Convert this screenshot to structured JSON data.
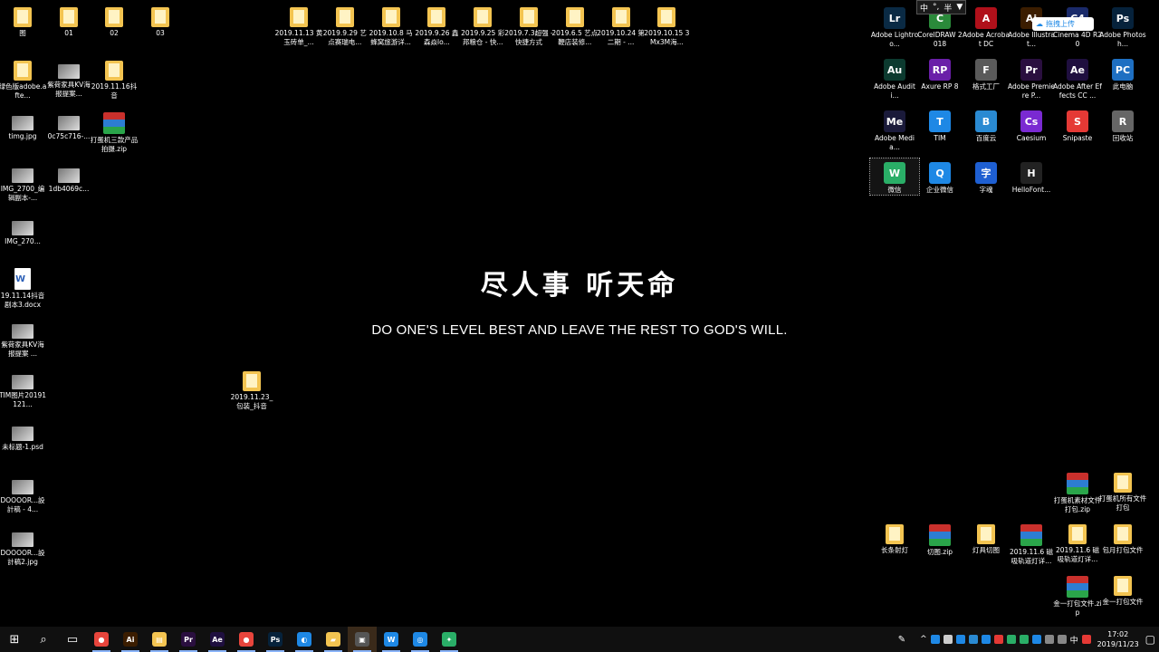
{
  "desktop": {
    "icons_left": [
      {
        "label": "图",
        "kind": "folder"
      },
      {
        "label": "01",
        "kind": "folder"
      },
      {
        "label": "02",
        "kind": "folder"
      },
      {
        "label": "03",
        "kind": "folder"
      },
      {
        "label": "绿色版adobe.afte...",
        "kind": "folder"
      },
      {
        "label": "紫荷家具KV海报提案...",
        "kind": "img"
      },
      {
        "label": "2019.11.16抖音",
        "kind": "folder"
      },
      {
        "label": "timg.jpg",
        "kind": "img"
      },
      {
        "label": "0c75c716-...",
        "kind": "img"
      },
      {
        "label": "打蛋机三款产品拍摄.zip",
        "kind": "zip"
      },
      {
        "label": "IMG_2700_编辑副本-...",
        "kind": "img"
      },
      {
        "label": "1db4069c...",
        "kind": "img"
      },
      {
        "label": "IMG_270...",
        "kind": "img"
      },
      {
        "label": "19.11.14抖音剧本3.docx",
        "kind": "doc"
      },
      {
        "label": "紫荷家具KV海报提案 ...",
        "kind": "img"
      },
      {
        "label": "TIM图片20191121...",
        "kind": "img"
      },
      {
        "label": "未标题-1.psd",
        "kind": "img"
      },
      {
        "label": "DOOOOR...設計稿 - 4...",
        "kind": "img"
      },
      {
        "label": "DOOOOR...設計稿2.jpg",
        "kind": "img"
      },
      {
        "label": "2019.11.23_包装_抖音",
        "kind": "folder"
      }
    ],
    "icons_top": [
      {
        "label": "2019.11.13 黄玉砖单_..."
      },
      {
        "label": "2019.9.29 艺点赛瑞电..."
      },
      {
        "label": "2019.10.8 马蜂窝旅游详..."
      },
      {
        "label": "2019.9.26 鑫森焱lo..."
      },
      {
        "label": "2019.9.25 彩邦粮仓 - 快..."
      },
      {
        "label": "2019.7.3超强 - 快捷方式"
      },
      {
        "label": "2019.6.5 艺点鞭店装修..."
      },
      {
        "label": "2019.10.24 第二期 - ..."
      },
      {
        "label": "2019.10.15 3Mx3M海..."
      }
    ],
    "icons_right": [
      {
        "label": "Adobe Lightroo...",
        "glyph": "Lr",
        "color": "#0a2a44"
      },
      {
        "label": "CorelDRAW 2018",
        "glyph": "C",
        "color": "#2a8a3a"
      },
      {
        "label": "Adobe Acrobat DC",
        "glyph": "A",
        "color": "#b0101a"
      },
      {
        "label": "Adobe Illustrat...",
        "glyph": "Ai",
        "color": "#3b1d00"
      },
      {
        "label": "Cinema 4D R20",
        "glyph": "C4",
        "color": "#1a2a6a"
      },
      {
        "label": "Adobe Photosh...",
        "glyph": "Ps",
        "color": "#06223b"
      },
      {
        "label": "Adobe Auditi...",
        "glyph": "Au",
        "color": "#0c3a2f"
      },
      {
        "label": "Axure RP 8",
        "glyph": "RP",
        "color": "#6a1fa8"
      },
      {
        "label": "格式工厂",
        "glyph": "F",
        "color": "#5a5a5a"
      },
      {
        "label": "Adobe Premiere P...",
        "glyph": "Pr",
        "color": "#2a0f3f"
      },
      {
        "label": "Adobe After Effects CC ...",
        "glyph": "Ae",
        "color": "#1f0f3f"
      },
      {
        "label": "此电脑",
        "glyph": "PC",
        "color": "#1e6fc2"
      },
      {
        "label": "Adobe Media...",
        "glyph": "Me",
        "color": "#1a1a3a"
      },
      {
        "label": "TIM",
        "glyph": "T",
        "color": "#1e88e5"
      },
      {
        "label": "百度云",
        "glyph": "B",
        "color": "#2a8ad2"
      },
      {
        "label": "Caesium",
        "glyph": "Cs",
        "color": "#7a2ad2"
      },
      {
        "label": "Snipaste",
        "glyph": "S",
        "color": "#e53935"
      },
      {
        "label": "回收站",
        "glyph": "R",
        "color": "#666"
      },
      {
        "label": "微信",
        "glyph": "W",
        "color": "#2aae67"
      },
      {
        "label": "企业微信",
        "glyph": "Q",
        "color": "#1e88e5"
      },
      {
        "label": "字魂",
        "glyph": "字",
        "color": "#1e5fd2"
      },
      {
        "label": "HelloFont...",
        "glyph": "H",
        "color": "#222"
      }
    ],
    "icons_bottom_right": [
      {
        "label": "打蛋机素材文件打包.zip",
        "kind": "zip"
      },
      {
        "label": "打蛋机所有文件打包",
        "kind": "folder"
      },
      {
        "label": "长条射灯",
        "kind": "folder"
      },
      {
        "label": "切图.zip",
        "kind": "zip"
      },
      {
        "label": "灯具切图",
        "kind": "folder"
      },
      {
        "label": "2019.11.6 磁吸轨道灯详...",
        "kind": "zip"
      },
      {
        "label": "2019.11.6 磁吸轨道灯详...",
        "kind": "folder"
      },
      {
        "label": "包月打包文件",
        "kind": "folder"
      },
      {
        "label": "金一打包文件.zip",
        "kind": "zip"
      },
      {
        "label": "金一打包文件",
        "kind": "folder"
      }
    ],
    "motto_cn": "尽人事 听天命",
    "motto_en": "DO ONE'S LEVEL BEST AND LEAVE THE REST TO GOD'S WILL.",
    "ime": {
      "mode": "中",
      "punct": "°,",
      "width": "半"
    },
    "upload_label": "拖拽上传"
  },
  "taskbar": {
    "apps": [
      {
        "name": "start",
        "glyph": "⊞",
        "color": "#101010"
      },
      {
        "name": "search",
        "glyph": "⌕",
        "color": "#101010"
      },
      {
        "name": "task-view",
        "glyph": "▭",
        "color": "#101010"
      },
      {
        "name": "chrome",
        "glyph": "●",
        "color": "#e8453c"
      },
      {
        "name": "illustrator",
        "glyph": "Ai",
        "color": "#3b1d00"
      },
      {
        "name": "notes",
        "glyph": "▤",
        "color": "#f3c451"
      },
      {
        "name": "premiere",
        "glyph": "Pr",
        "color": "#2a0f3f"
      },
      {
        "name": "after-effects",
        "glyph": "Ae",
        "color": "#1f0f3f"
      },
      {
        "name": "chrome-2",
        "glyph": "●",
        "color": "#e8453c"
      },
      {
        "name": "photoshop",
        "glyph": "Ps",
        "color": "#06223b"
      },
      {
        "name": "browser",
        "glyph": "◐",
        "color": "#1e88e5"
      },
      {
        "name": "file-explorer",
        "glyph": "▰",
        "color": "#f3c451"
      },
      {
        "name": "player",
        "glyph": "▣",
        "color": "#555"
      },
      {
        "name": "wps",
        "glyph": "W",
        "color": "#1e88e5"
      },
      {
        "name": "tim",
        "glyph": "◎",
        "color": "#1e88e5"
      },
      {
        "name": "wechat",
        "glyph": "✦",
        "color": "#2aae67"
      }
    ],
    "tray": {
      "lang": "中",
      "time": "17:02",
      "date": "2019/11/23"
    }
  }
}
